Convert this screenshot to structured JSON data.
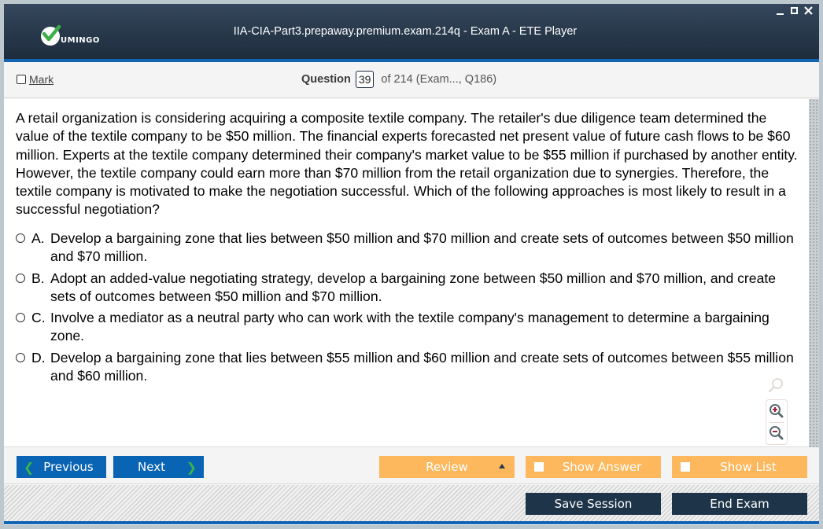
{
  "window": {
    "title": "IIA-CIA-Part3.prepaway.premium.exam.214q - Exam A - ETE Player",
    "logo_text": "UMINGO",
    "controls": [
      "minimize",
      "maximize",
      "close"
    ]
  },
  "header": {
    "mark_label": "Mark",
    "mark_checked": false,
    "question_label": "Question",
    "question_number": "39",
    "question_rest": "of 214 (Exam..., Q186)"
  },
  "question": {
    "text": "A retail organization is considering acquiring a composite textile company. The retailer's due diligence team determined the value of the textile company to be $50 million. The financial experts forecasted net present value of future cash flows to be $60 million. Experts at the textile company determined their company's market value to be $55 million if purchased by another entity. However, the textile company could earn more than $70 million from the retail organization due to synergies. Therefore, the textile company is motivated to make the negotiation successful. Which of the following approaches is most likely to result in a successful negotiation?",
    "answers": [
      {
        "letter": "A.",
        "text": "Develop a bargaining zone that lies between $50 million and $70 million and create sets of outcomes between $50 million and $70 million.",
        "selected": false
      },
      {
        "letter": "B.",
        "text": "Adopt an added-value negotiating strategy, develop a bargaining zone between $50 million and $70 million, and create sets of outcomes between $50 million and $70 million.",
        "selected": false
      },
      {
        "letter": "C.",
        "text": "Involve a mediator as a neutral party who can work with the textile company's management to determine a bargaining zone.",
        "selected": false
      },
      {
        "letter": "D.",
        "text": "Develop a bargaining zone that lies between $55 million and $60 million and create sets of outcomes between $55 million and $60 million.",
        "selected": false
      }
    ]
  },
  "zoom_tools": [
    "zoom-reset-icon",
    "zoom-in-icon",
    "zoom-out-icon"
  ],
  "nav": {
    "previous_label": "Previous",
    "next_label": "Next",
    "review_label": "Review",
    "show_answer_label": "Show Answer",
    "show_answer_checked": false,
    "show_list_label": "Show List",
    "show_list_checked": false
  },
  "footer": {
    "save_session_label": "Save Session",
    "end_exam_label": "End Exam"
  },
  "colors": {
    "titlebar": "#253447",
    "accent_blue": "#1464b4",
    "nav_blue": "#0a64b4",
    "orange": "#fdb85d",
    "dark_button": "#1e3448",
    "chevron_green": "#38b44a"
  }
}
